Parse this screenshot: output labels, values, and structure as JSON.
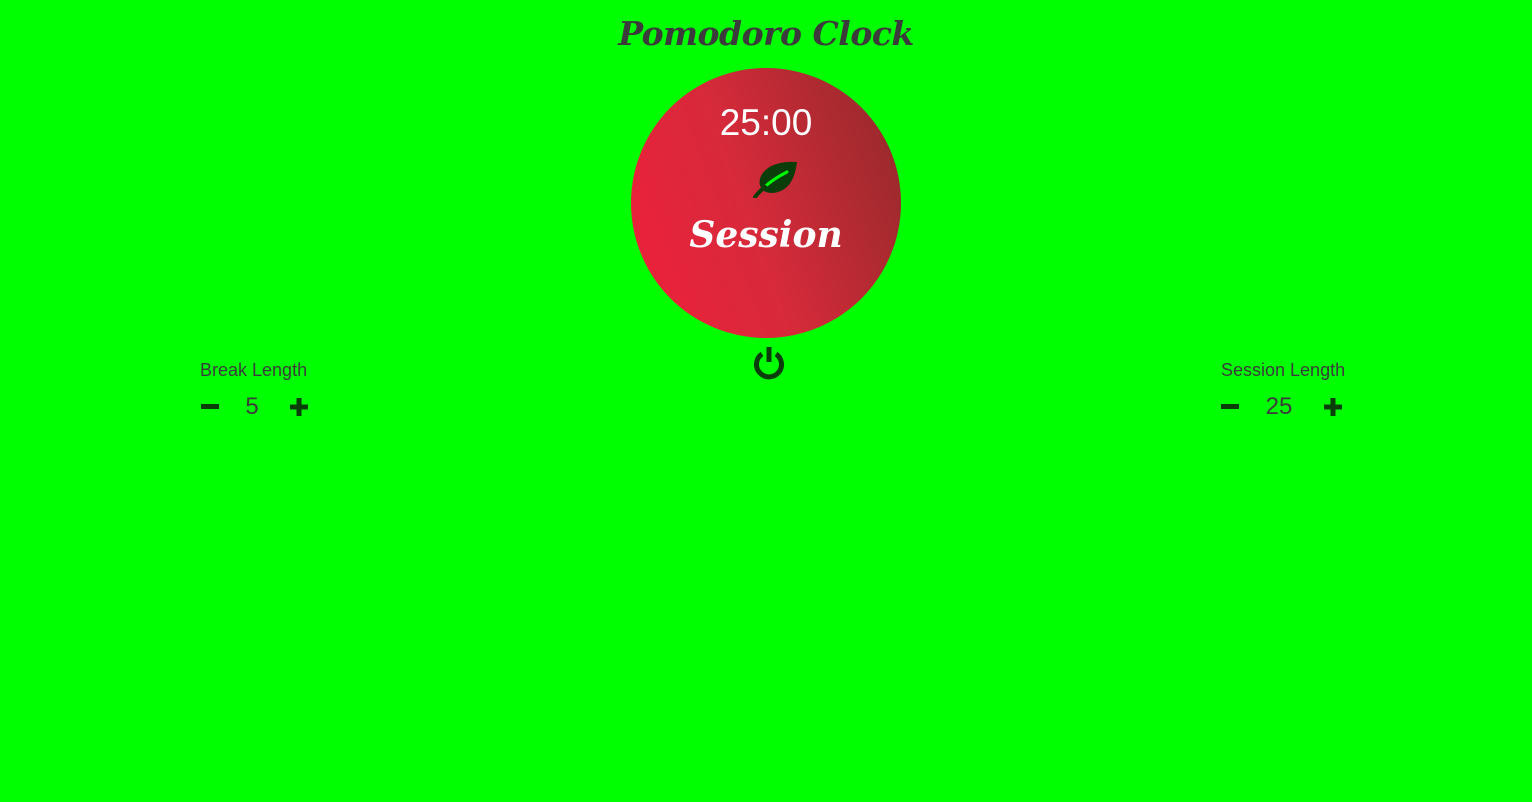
{
  "app": {
    "title": "Pomodoro Clock"
  },
  "timer": {
    "time": "25:00",
    "mode": "Session",
    "icon": "leaf-icon"
  },
  "controls": {
    "power_icon": "power-icon",
    "decrement_icon": "minus-icon",
    "increment_icon": "plus-icon"
  },
  "break_length": {
    "label": "Break Length",
    "value": "5"
  },
  "session_length": {
    "label": "Session Length",
    "value": "25"
  },
  "colors": {
    "background": "#00ff00",
    "text": "#3b3b3b",
    "clock_gradient_start": "#f01f3b",
    "clock_gradient_end": "#8f2a2a",
    "icon": "#0b3d0b",
    "timer_text": "#ffffff"
  }
}
